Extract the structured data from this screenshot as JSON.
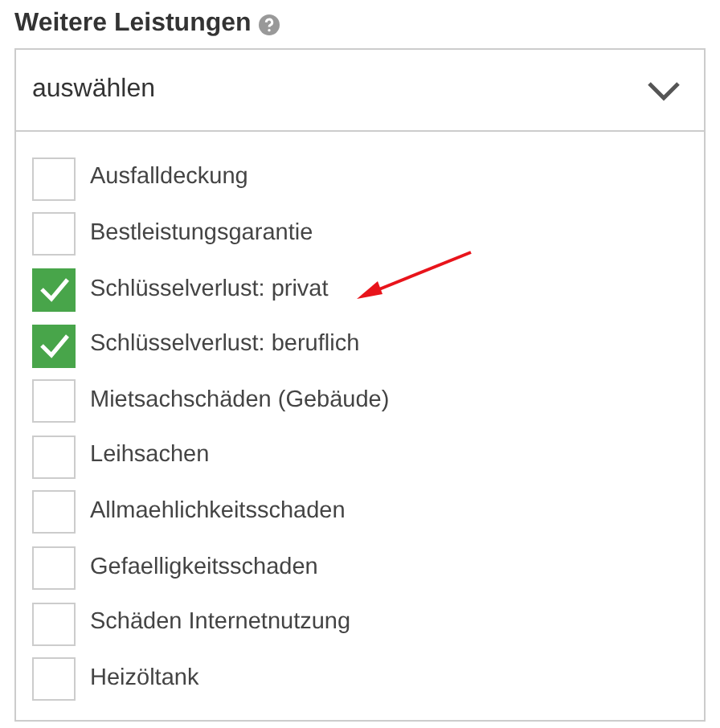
{
  "title": "Weitere Leistungen",
  "select": {
    "value": "auswählen",
    "expanded": true
  },
  "options": [
    {
      "label": "Ausfalldeckung",
      "checked": false
    },
    {
      "label": "Bestleistungsgarantie",
      "checked": false
    },
    {
      "label": "Schlüsselverlust: privat",
      "checked": true
    },
    {
      "label": "Schlüsselverlust: beruflich",
      "checked": true
    },
    {
      "label": "Mietsachschäden (Gebäude)",
      "checked": false
    },
    {
      "label": "Leihsachen",
      "checked": false
    },
    {
      "label": "Allmaehlichkeitsschaden",
      "checked": false
    },
    {
      "label": "Gefaelligkeitsschaden",
      "checked": false
    },
    {
      "label": "Schäden Internetnutzung",
      "checked": false
    },
    {
      "label": "Heizöltank",
      "checked": false
    }
  ]
}
